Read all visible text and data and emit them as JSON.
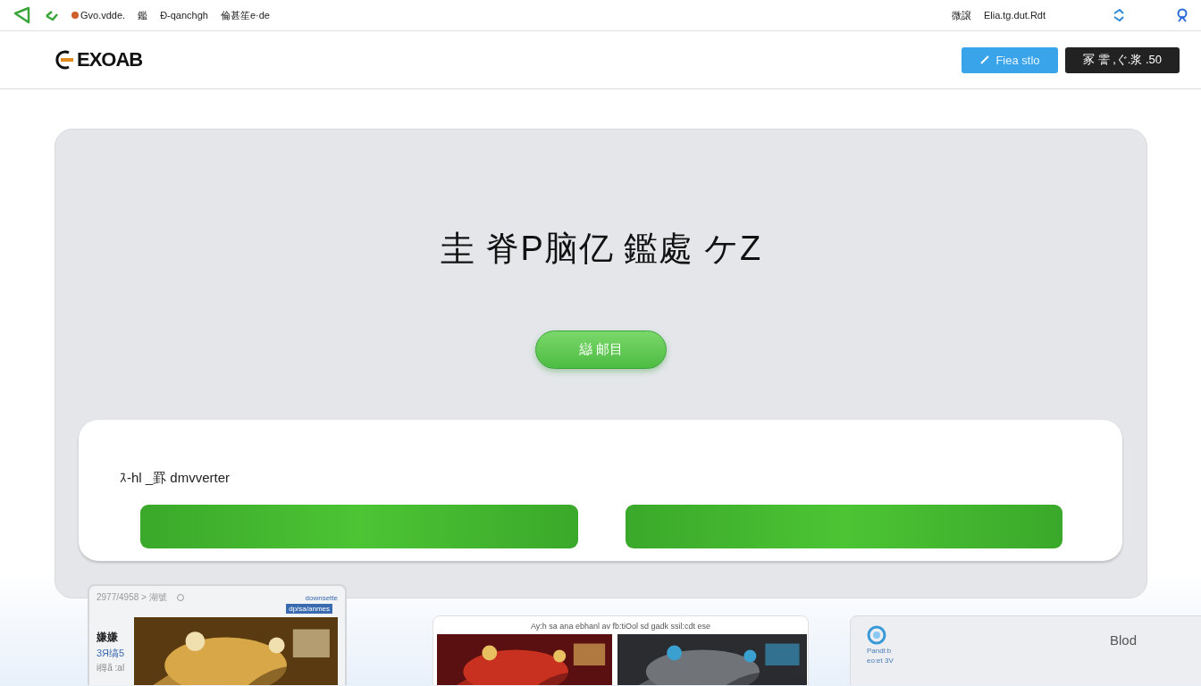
{
  "top_bar": {
    "nav": [
      "Gvo.vdde.",
      "鑑",
      "Ð-qanchgh",
      "倫甚笙e·de"
    ],
    "right_links": [
      "微譲",
      "Elia.tg.dut.Rdt"
    ]
  },
  "header": {
    "logo": "EXOAB",
    "buttons": [
      {
        "label": "Fiea stlo",
        "kind": "primary"
      },
      {
        "label": "冢 霅 ,ぐ.浆 .50",
        "kind": "dark"
      }
    ]
  },
  "hero": {
    "title": "圭 脊P脑亿 鑑處 ケZ",
    "button": "䜌 邮目",
    "card": {
      "label": "ｽ-hl _罫 dmvverter"
    }
  },
  "previews": [
    {
      "kind": "window",
      "path": "2977/4958 > 湖號",
      "link": "downsette",
      "badge": "dp/sa/anmes",
      "side": [
        "嫌嫌",
        "3Я缟5",
        "i得ã :al"
      ]
    },
    {
      "kind": "gallery",
      "caption": "Ay:h sa ana ebhanl av fb:tiOol sd gadk ssil:cdt ese"
    },
    {
      "kind": "app",
      "title": "Blod",
      "lines": [
        "Pandl:b",
        "eo:et 3V"
      ]
    }
  ]
}
